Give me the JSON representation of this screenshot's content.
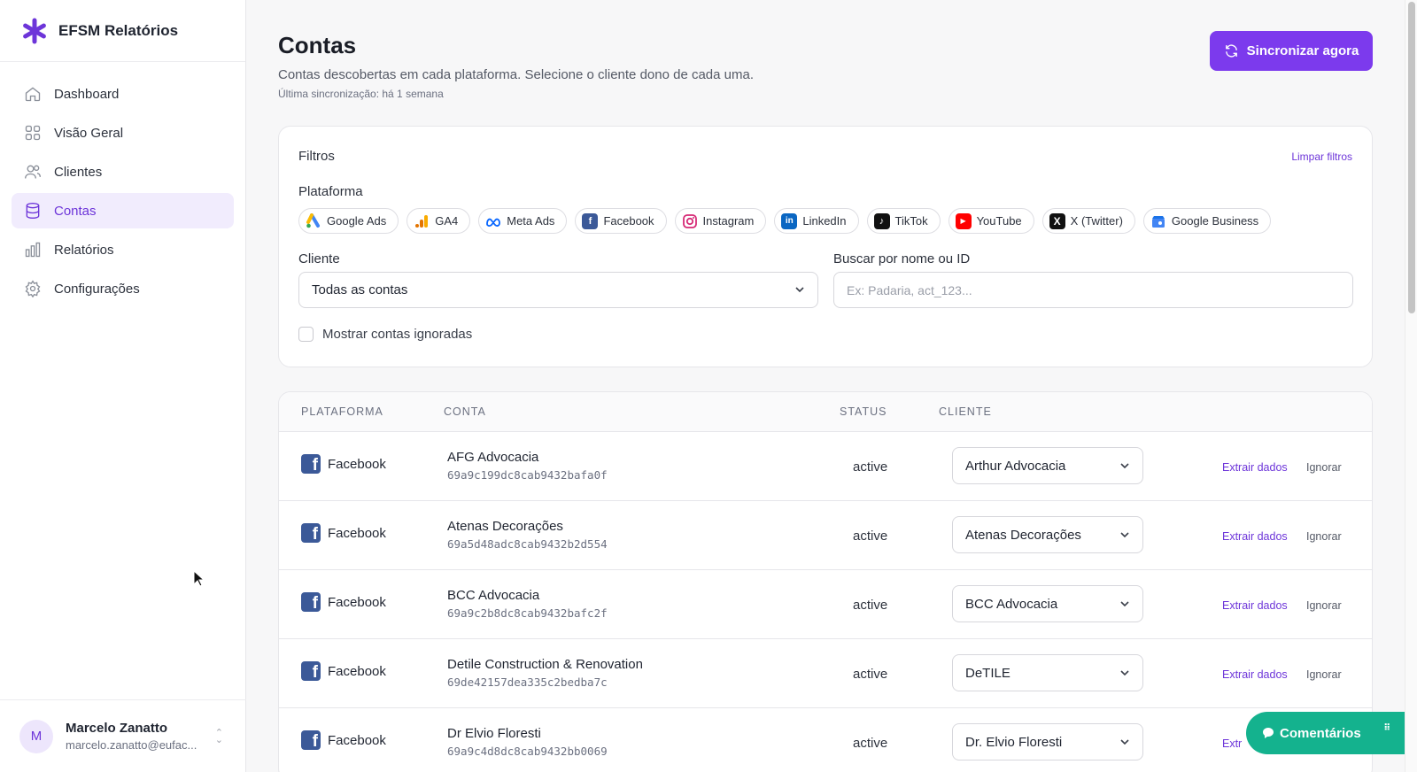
{
  "app": {
    "name": "EFSM Relatórios"
  },
  "sidebar": {
    "items": [
      {
        "label": "Dashboard",
        "icon": "home-icon"
      },
      {
        "label": "Visão Geral",
        "icon": "grid-icon"
      },
      {
        "label": "Clientes",
        "icon": "users-icon"
      },
      {
        "label": "Contas",
        "icon": "database-icon",
        "active": true
      },
      {
        "label": "Relatórios",
        "icon": "bar-chart-icon"
      },
      {
        "label": "Configurações",
        "icon": "gear-icon"
      }
    ]
  },
  "user": {
    "initial": "M",
    "name": "Marcelo Zanatto",
    "email": "marcelo.zanatto@eufac..."
  },
  "header": {
    "title": "Contas",
    "subtitle": "Contas descobertas em cada plataforma. Selecione o cliente dono de cada uma.",
    "last_sync": "Última sincronização: há 1 semana",
    "sync_button": "Sincronizar agora"
  },
  "filters": {
    "title": "Filtros",
    "clear": "Limpar filtros",
    "platform_label": "Plataforma",
    "platforms": [
      {
        "label": "Google Ads",
        "icon": "google-ads-icon",
        "color": "#4285f4"
      },
      {
        "label": "GA4",
        "icon": "ga4-icon",
        "color": "#f9ab00"
      },
      {
        "label": "Meta Ads",
        "icon": "meta-icon",
        "color": "#0866ff"
      },
      {
        "label": "Facebook",
        "icon": "facebook-icon",
        "color": "#3b5998"
      },
      {
        "label": "Instagram",
        "icon": "instagram-icon",
        "color": "#d62976"
      },
      {
        "label": "LinkedIn",
        "icon": "linkedin-icon",
        "color": "#0a66c2"
      },
      {
        "label": "TikTok",
        "icon": "tiktok-icon",
        "color": "#111111"
      },
      {
        "label": "YouTube",
        "icon": "youtube-icon",
        "color": "#ff0000"
      },
      {
        "label": "X (Twitter)",
        "icon": "x-icon",
        "color": "#111111"
      },
      {
        "label": "Google Business",
        "icon": "google-business-icon",
        "color": "#4285f4"
      }
    ],
    "client_label": "Cliente",
    "client_value": "Todas as contas",
    "search_label": "Buscar por nome ou ID",
    "search_placeholder": "Ex: Padaria, act_123...",
    "show_ignored": "Mostrar contas ignoradas"
  },
  "table": {
    "columns": [
      "PLATAFORMA",
      "CONTA",
      "STATUS",
      "CLIENTE"
    ],
    "rows": [
      {
        "platform": "Facebook",
        "name": "AFG Advocacia",
        "id": "69a9c199dc8cab9432bafa0f",
        "status": "active",
        "client": "Arthur Advocacia",
        "extract": "Extrair dados",
        "ignore": "Ignorar"
      },
      {
        "platform": "Facebook",
        "name": "Atenas Decorações",
        "id": "69a5d48adc8cab9432b2d554",
        "status": "active",
        "client": "Atenas Decorações",
        "extract": "Extrair dados",
        "ignore": "Ignorar"
      },
      {
        "platform": "Facebook",
        "name": "BCC Advocacia",
        "id": "69a9c2b8dc8cab9432bafc2f",
        "status": "active",
        "client": "BCC Advocacia",
        "extract": "Extrair dados",
        "ignore": "Ignorar"
      },
      {
        "platform": "Facebook",
        "name": "Detile Construction & Renovation",
        "id": "69de42157dea335c2bedba7c",
        "status": "active",
        "client": "DeTILE",
        "extract": "Extrair dados",
        "ignore": "Ignorar"
      },
      {
        "platform": "Facebook",
        "name": "Dr Elvio Floresti",
        "id": "69a9c4d8dc8cab9432bb0069",
        "status": "active",
        "client": "Dr. Elvio Floresti",
        "extract": "Extr",
        "ignore": ""
      }
    ]
  },
  "feedback": {
    "label": "Comentários",
    "color": "#14b28e"
  },
  "colors": {
    "accent": "#7c3aed",
    "accent_text": "#6d35d9",
    "active_bg": "#f1ecfd"
  }
}
